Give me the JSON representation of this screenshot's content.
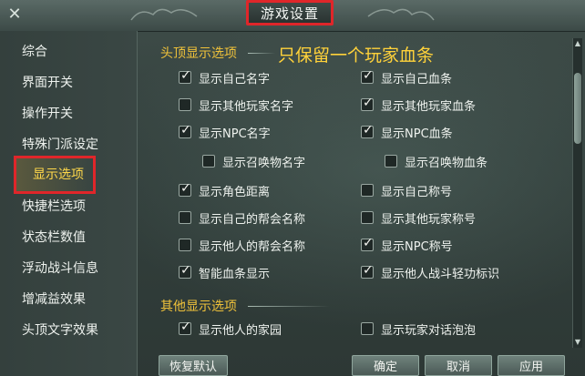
{
  "window": {
    "title": "游戏设置",
    "close_glyph": "✕"
  },
  "sidebar": {
    "items": [
      {
        "label": "综合",
        "active": false
      },
      {
        "label": "界面开关",
        "active": false
      },
      {
        "label": "操作开关",
        "active": false
      },
      {
        "label": "特殊门派设定",
        "active": false
      },
      {
        "label": "显示选项",
        "active": true
      },
      {
        "label": "快捷栏选项",
        "active": false
      },
      {
        "label": "状态栏数值",
        "active": false
      },
      {
        "label": "浮动战斗信息",
        "active": false
      },
      {
        "label": "增减益效果",
        "active": false
      },
      {
        "label": "头顶文字效果",
        "active": false
      }
    ]
  },
  "content": {
    "section1_title": "头顶显示选项",
    "annotation": "只保留一个玩家血条",
    "section1_options": [
      {
        "label": "显示自己名字",
        "checked": true
      },
      {
        "label": "显示自己血条",
        "checked": true
      },
      {
        "label": "显示其他玩家名字",
        "checked": false
      },
      {
        "label": "显示其他玩家血条",
        "checked": true
      },
      {
        "label": "显示NPC名字",
        "checked": true
      },
      {
        "label": "显示NPC血条",
        "checked": true
      },
      {
        "label": "显示召唤物名字",
        "checked": false
      },
      {
        "label": "显示召唤物血条",
        "checked": false
      },
      {
        "label": "显示角色距离",
        "checked": true
      },
      {
        "label": "显示自己称号",
        "checked": false
      },
      {
        "label": "显示自己的帮会名称",
        "checked": false
      },
      {
        "label": "显示其他玩家称号",
        "checked": false
      },
      {
        "label": "显示他人的帮会名称",
        "checked": false
      },
      {
        "label": "显示NPC称号",
        "checked": true
      },
      {
        "label": "智能血条显示",
        "checked": true
      },
      {
        "label": "显示他人战斗轻功标识",
        "checked": true
      }
    ],
    "section2_title": "其他显示选项",
    "section2_options": [
      {
        "label": "显示他人的家园",
        "checked": true
      },
      {
        "label": "显示玩家对话泡泡",
        "checked": false
      }
    ]
  },
  "buttons": {
    "restore_default": "恢复默认",
    "confirm": "确定",
    "cancel": "取消",
    "apply": "应用"
  },
  "colors": {
    "highlight_red": "#e0262a",
    "section_gold": "#f0c23a",
    "annotation_yellow": "#ffd23a"
  }
}
